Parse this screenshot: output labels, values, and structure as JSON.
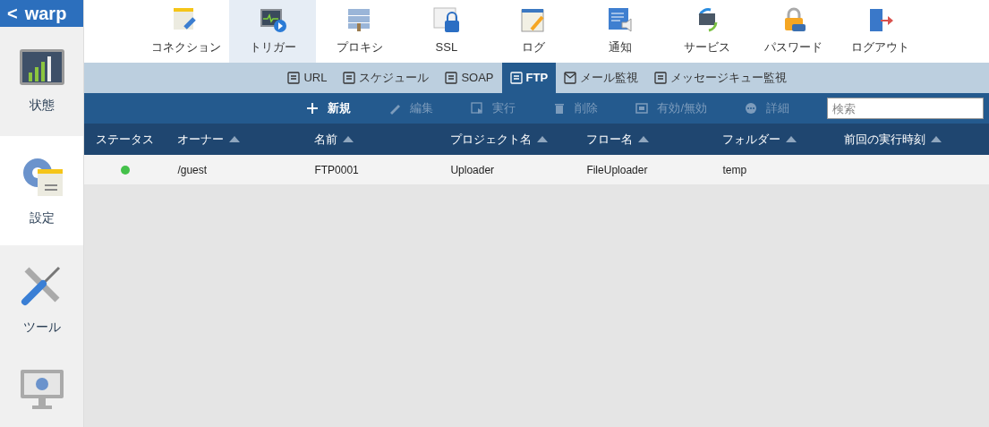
{
  "logo": {
    "back": "<",
    "text": "warp"
  },
  "sidebar": {
    "items": [
      {
        "label": "状態",
        "selected": false
      },
      {
        "label": "設定",
        "selected": true
      },
      {
        "label": "ツール",
        "selected": false
      }
    ]
  },
  "top_nav": [
    {
      "label": "コネクション",
      "selected": false
    },
    {
      "label": "トリガー",
      "selected": true
    },
    {
      "label": "プロキシ",
      "selected": false
    },
    {
      "label": "SSL",
      "selected": false
    },
    {
      "label": "ログ",
      "selected": false
    },
    {
      "label": "通知",
      "selected": false
    },
    {
      "label": "サービス",
      "selected": false
    },
    {
      "label": "パスワード",
      "selected": false
    },
    {
      "label": "ログアウト",
      "selected": false
    }
  ],
  "sub_tabs": [
    {
      "label": "URL",
      "selected": false
    },
    {
      "label": "スケジュール",
      "selected": false
    },
    {
      "label": "SOAP",
      "selected": false
    },
    {
      "label": "FTP",
      "selected": true
    },
    {
      "label": "メール監視",
      "selected": false
    },
    {
      "label": "メッセージキュー監視",
      "selected": false
    }
  ],
  "toolbar": {
    "buttons": [
      {
        "label": "新規",
        "disabled": false
      },
      {
        "label": "編集",
        "disabled": true
      },
      {
        "label": "実行",
        "disabled": true
      },
      {
        "label": "削除",
        "disabled": true
      },
      {
        "label": "有効/無効",
        "disabled": true
      },
      {
        "label": "詳細",
        "disabled": true
      }
    ],
    "search": {
      "placeholder": "検索"
    }
  },
  "table": {
    "columns": [
      {
        "label": "ステータス"
      },
      {
        "label": "オーナー",
        "sortable": true
      },
      {
        "label": "名前",
        "sortable": true
      },
      {
        "label": "プロジェクト名",
        "sortable": true
      },
      {
        "label": "フロー名",
        "sortable": true
      },
      {
        "label": "フォルダー",
        "sortable": true
      },
      {
        "label": "前回の実行時刻",
        "sortable": true
      }
    ],
    "rows": [
      {
        "cells": [
          {
            "kind": "status",
            "color": "#44c14a"
          },
          {
            "kind": "text",
            "text": "/guest"
          },
          {
            "kind": "text",
            "text": "FTP0001"
          },
          {
            "kind": "text",
            "text": "Uploader"
          },
          {
            "kind": "text",
            "text": "FileUploader"
          },
          {
            "kind": "text",
            "text": "temp"
          }
        ]
      }
    ]
  }
}
